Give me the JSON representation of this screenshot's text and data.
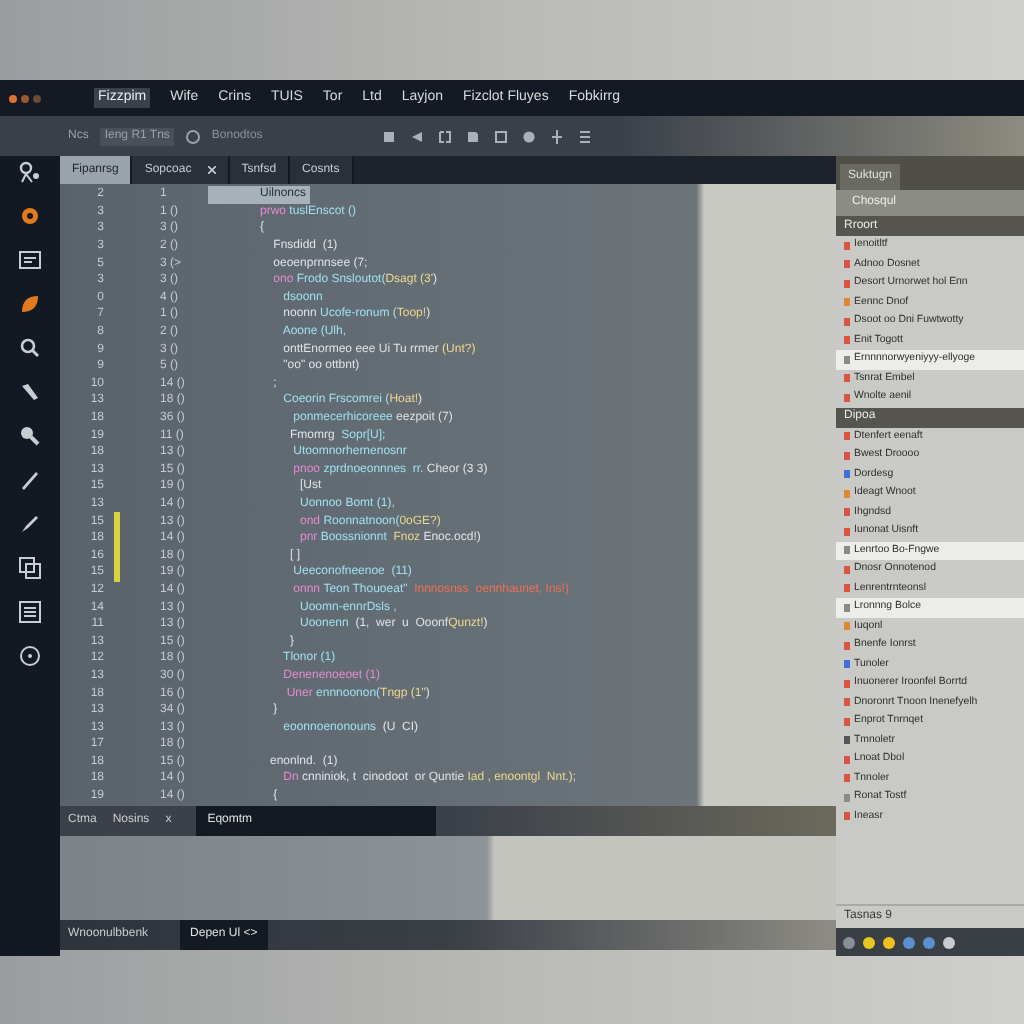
{
  "menu": [
    {
      "label": "Fizzpim",
      "selected": true
    },
    {
      "label": "Wife",
      "selected": false
    },
    {
      "label": "Crins",
      "selected": false
    },
    {
      "label": "TUIS",
      "selected": false
    },
    {
      "label": "Tor",
      "selected": false
    },
    {
      "label": "Ltd",
      "selected": false
    },
    {
      "label": "Layjon",
      "selected": false
    },
    {
      "label": "Fizclot Fluyes",
      "selected": false
    },
    {
      "label": "Fobkirrg",
      "selected": false
    }
  ],
  "toolbar": {
    "label": "Ncs",
    "field": "Ieng R1 Tns",
    "breadcrumb": "Bonodtos"
  },
  "tabs": [
    {
      "label": "Fipanrsg",
      "selected": true,
      "closable": false
    },
    {
      "label": "Sopcoac",
      "selected": false,
      "closable": true
    },
    {
      "label": "Tsnfsd",
      "selected": false,
      "closable": false
    },
    {
      "label": "Cosnts",
      "selected": false,
      "closable": false
    }
  ],
  "code": [
    {
      "n": "2",
      "m": "1",
      "current": true,
      "marked": false,
      "segs": [
        {
          "kind": "plain",
          "text": "Uilnoncs"
        }
      ]
    },
    {
      "n": "3",
      "m": "1 ()",
      "current": false,
      "marked": false,
      "segs": [
        {
          "kind": "kw",
          "text": "prwo "
        },
        {
          "kind": "fn",
          "text": "tuslEnscot ()"
        }
      ]
    },
    {
      "n": "3",
      "m": "3 ()",
      "current": false,
      "marked": false,
      "segs": [
        {
          "kind": "plain",
          "text": "{"
        }
      ]
    },
    {
      "n": "3",
      "m": "2 ()",
      "current": false,
      "marked": false,
      "segs": [
        {
          "kind": "plain",
          "text": "    Fnsdidd  (1)"
        }
      ]
    },
    {
      "n": "5",
      "m": "3 (>",
      "current": false,
      "marked": false,
      "segs": [
        {
          "kind": "plain",
          "text": "    oeoenprnnsee (7;"
        }
      ]
    },
    {
      "n": "3",
      "m": "3 ()",
      "current": false,
      "marked": false,
      "segs": [
        {
          "kind": "kw",
          "text": "    ono "
        },
        {
          "kind": "fn",
          "text": "Frodo Snsloutot("
        },
        {
          "kind": "str",
          "text": "Dsagt (3'"
        },
        {
          "kind": "plain",
          "text": ")"
        }
      ]
    },
    {
      "n": "0",
      "m": "4 ()",
      "current": false,
      "marked": false,
      "segs": [
        {
          "kind": "fn",
          "text": "       dsoonn"
        }
      ]
    },
    {
      "n": "7",
      "m": "1 ()",
      "current": false,
      "marked": false,
      "segs": [
        {
          "kind": "plain",
          "text": "       noonn "
        },
        {
          "kind": "fn",
          "text": "Ucofe-ronum ("
        },
        {
          "kind": "str",
          "text": "Toop!"
        },
        {
          "kind": "plain",
          "text": ")"
        }
      ]
    },
    {
      "n": "8",
      "m": "2 ()",
      "current": false,
      "marked": false,
      "segs": [
        {
          "kind": "fn",
          "text": "       Aoone (Ulh,"
        }
      ]
    },
    {
      "n": "9",
      "m": "3 ()",
      "current": false,
      "marked": false,
      "segs": [
        {
          "kind": "plain",
          "text": "       onttEnormeo eee Ui Tu rrmer "
        },
        {
          "kind": "str",
          "text": "(Unt?)"
        }
      ]
    },
    {
      "n": "9",
      "m": "5 ()",
      "current": false,
      "marked": false,
      "segs": [
        {
          "kind": "plain",
          "text": "       \"oo\" oo ottbnt)"
        }
      ]
    },
    {
      "n": "10",
      "m": "14 ()",
      "current": false,
      "marked": false,
      "segs": [
        {
          "kind": "plain",
          "text": "    ;"
        }
      ]
    },
    {
      "n": "13",
      "m": "18 ()",
      "current": false,
      "marked": false,
      "segs": [
        {
          "kind": "fn",
          "text": "       Coeorin Frscomrei ("
        },
        {
          "kind": "str",
          "text": "Hoat!"
        },
        {
          "kind": "plain",
          "text": ")"
        }
      ]
    },
    {
      "n": "18",
      "m": "36 ()",
      "current": false,
      "marked": false,
      "segs": [
        {
          "kind": "fn",
          "text": "          ponmecerhicoreee "
        },
        {
          "kind": "plain",
          "text": "eezpoit (7)"
        }
      ]
    },
    {
      "n": "19",
      "m": "11 ()",
      "current": false,
      "marked": false,
      "segs": [
        {
          "kind": "plain",
          "text": "         Fmomrg  "
        },
        {
          "kind": "fn",
          "text": "Sopr[U];"
        }
      ]
    },
    {
      "n": "18",
      "m": "13 ()",
      "current": false,
      "marked": false,
      "segs": [
        {
          "kind": "fn",
          "text": "          Utoomnorhernenosnr"
        }
      ]
    },
    {
      "n": "13",
      "m": "15 ()",
      "current": false,
      "marked": false,
      "segs": [
        {
          "kind": "kw",
          "text": "          pnoo "
        },
        {
          "kind": "fn",
          "text": "zprdnoeonnnes  rr. "
        },
        {
          "kind": "plain",
          "text": "Cheor (3 3)"
        }
      ]
    },
    {
      "n": "15",
      "m": "19 ()",
      "current": false,
      "marked": false,
      "segs": [
        {
          "kind": "plain",
          "text": "            [Ust"
        }
      ]
    },
    {
      "n": "13",
      "m": "14 ()",
      "current": false,
      "marked": false,
      "segs": [
        {
          "kind": "fn",
          "text": "            Uonnoo Bomt (1),"
        }
      ]
    },
    {
      "n": "15",
      "m": "13 ()",
      "current": false,
      "marked": true,
      "segs": [
        {
          "kind": "kw",
          "text": "            ond "
        },
        {
          "kind": "fn",
          "text": "Roonnatnoon("
        },
        {
          "kind": "str",
          "text": "0oGE?)"
        }
      ]
    },
    {
      "n": "18",
      "m": "14 ()",
      "current": false,
      "marked": true,
      "segs": [
        {
          "kind": "kw",
          "text": "            pnr "
        },
        {
          "kind": "fn",
          "text": "Boossnionnt  "
        },
        {
          "kind": "str",
          "text": "Fnoz "
        },
        {
          "kind": "plain",
          "text": "Enoc.ocd!)"
        }
      ]
    },
    {
      "n": "16",
      "m": "18 ()",
      "current": false,
      "marked": true,
      "segs": [
        {
          "kind": "plain",
          "text": "         [ ]"
        }
      ]
    },
    {
      "n": "15",
      "m": "19 ()",
      "current": false,
      "marked": true,
      "segs": [
        {
          "kind": "fn",
          "text": "          Ueeconofneenoe  (11)"
        }
      ]
    },
    {
      "n": "12",
      "m": "14 ()",
      "current": false,
      "marked": false,
      "segs": [
        {
          "kind": "kw",
          "text": "          onnn "
        },
        {
          "kind": "fn",
          "text": "Teon Thouoeat\"  "
        },
        {
          "kind": "err",
          "text": "Innnosnss  oennhaunet, Ins!)"
        }
      ]
    },
    {
      "n": "14",
      "m": "13 ()",
      "current": false,
      "marked": false,
      "segs": [
        {
          "kind": "fn",
          "text": "            Uoomn-ennrDsls ,"
        }
      ]
    },
    {
      "n": "11",
      "m": "13 ()",
      "current": false,
      "marked": false,
      "segs": [
        {
          "kind": "fn",
          "text": "            Uoonenn  "
        },
        {
          "kind": "plain",
          "text": "(1,  wer  u  Ooonf"
        },
        {
          "kind": "str",
          "text": "Qunzt!"
        },
        {
          "kind": "plain",
          "text": ")"
        }
      ]
    },
    {
      "n": "13",
      "m": "15 ()",
      "current": false,
      "marked": false,
      "segs": [
        {
          "kind": "plain",
          "text": "         }"
        }
      ]
    },
    {
      "n": "12",
      "m": "18 ()",
      "current": false,
      "marked": false,
      "segs": [
        {
          "kind": "fn",
          "text": "       Tlonor (1)"
        }
      ]
    },
    {
      "n": "13",
      "m": "30 ()",
      "current": false,
      "marked": false,
      "segs": [
        {
          "kind": "kw",
          "text": "       Denenenoeoet (1)"
        }
      ]
    },
    {
      "n": "18",
      "m": "16 ()",
      "current": false,
      "marked": false,
      "segs": [
        {
          "kind": "kw",
          "text": "        Uner "
        },
        {
          "kind": "fn",
          "text": "ennnoonon("
        },
        {
          "kind": "str",
          "text": "Tngp (1\""
        },
        {
          "kind": "plain",
          "text": ")"
        }
      ]
    },
    {
      "n": "13",
      "m": "34 ()",
      "current": false,
      "marked": false,
      "segs": [
        {
          "kind": "plain",
          "text": "    }"
        }
      ]
    },
    {
      "n": "13",
      "m": "13 ()",
      "current": false,
      "marked": false,
      "segs": [
        {
          "kind": "fn",
          "text": "       eoonnoenonouns  "
        },
        {
          "kind": "plain",
          "text": "(U  CI)"
        }
      ]
    },
    {
      "n": "17",
      "m": "18 ()",
      "current": false,
      "marked": false
    },
    {
      "n": "18",
      "m": "15 ()",
      "current": false,
      "marked": false,
      "segs": [
        {
          "kind": "plain",
          "text": "   enonlnd.  (1)"
        }
      ]
    },
    {
      "n": "18",
      "m": "14 ()",
      "current": false,
      "marked": false,
      "segs": [
        {
          "kind": "kw",
          "text": "       Dn "
        },
        {
          "kind": "plain",
          "text": "cnniniok, t  cinodoot  or Quntie "
        },
        {
          "kind": "str",
          "text": "Iad , enoontgl  Nnt.);"
        }
      ]
    },
    {
      "n": "19",
      "m": "14 ()",
      "current": false,
      "marked": false,
      "segs": [
        {
          "kind": "plain",
          "text": "    {"
        }
      ]
    }
  ],
  "panel_tabs": [
    {
      "label": "Ctma",
      "selected": false
    },
    {
      "label": "Nosins",
      "selected": false
    },
    {
      "label": "x",
      "selected": false
    },
    {
      "label": "Eqomtm",
      "selected": true
    }
  ],
  "status": [
    "Wnoonulbbenk",
    "Depen Ul <>"
  ],
  "sidebar": {
    "tab": "Suktugn",
    "button": "Chosqul",
    "footer": "Tasnas 9",
    "items": [
      {
        "kind": "section",
        "text": "Rroort"
      },
      {
        "kind": "item",
        "text": "Ienoitltf",
        "color": "#d9553f",
        "selected": false
      },
      {
        "kind": "item",
        "text": "Adnoo Dosnet",
        "color": "#d9553f",
        "selected": false
      },
      {
        "kind": "item",
        "text": "Desort Urnorwet hol Enn",
        "color": "#d9553f",
        "selected": false
      },
      {
        "kind": "item",
        "text": "Eennc Dnof",
        "color": "#e0892f",
        "selected": false
      },
      {
        "kind": "item",
        "text": "Dsoot oo Dni Fuwtwotty",
        "color": "#d9553f",
        "selected": false
      },
      {
        "kind": "item",
        "text": "Enit Togott",
        "color": "#d9553f",
        "selected": false
      },
      {
        "kind": "item",
        "text": "Ernnnnorwyeniyyy-ellyoge",
        "color": "#8a8a8a",
        "selected": true
      },
      {
        "kind": "item",
        "text": "Tsnrat Embel",
        "color": "#d9553f",
        "selected": false
      },
      {
        "kind": "item",
        "text": "Wnolte aenil",
        "color": "#d9553f",
        "selected": false
      },
      {
        "kind": "section",
        "text": "Dipoa"
      },
      {
        "kind": "item",
        "text": "Dtenfert eenaft",
        "color": "#d9553f",
        "selected": false
      },
      {
        "kind": "item",
        "text": "Bwest Droooo",
        "color": "#d9553f",
        "selected": false
      },
      {
        "kind": "item",
        "text": "Dordesg",
        "color": "#3f6fd9",
        "selected": false
      },
      {
        "kind": "item",
        "text": "Ideagt Wnoot",
        "color": "#e0892f",
        "selected": false
      },
      {
        "kind": "item",
        "text": "Ihgndsd",
        "color": "#d9553f",
        "selected": false
      },
      {
        "kind": "item",
        "text": "Iunonat Uisnft",
        "color": "#d9553f",
        "selected": false
      },
      {
        "kind": "item",
        "text": "Lenrtoo Bo-Fngwe",
        "color": "#8a8a8a",
        "selected": true
      },
      {
        "kind": "item",
        "text": "Dnosr Onnotenod",
        "color": "#d9553f",
        "selected": false
      },
      {
        "kind": "item",
        "text": "Lenrentrnteonsl",
        "color": "#d9553f",
        "selected": false
      },
      {
        "kind": "item",
        "text": "Lronnng Bolce",
        "color": "#8a8a8a",
        "selected": true
      },
      {
        "kind": "item",
        "text": "Iuqonl",
        "color": "#e0892f",
        "selected": false
      },
      {
        "kind": "item",
        "text": "Bnenfe Ionrst",
        "color": "#d9553f",
        "selected": false
      },
      {
        "kind": "item",
        "text": "Tunoler",
        "color": "#3f6fd9",
        "selected": false
      },
      {
        "kind": "item",
        "text": "Inuonerer Iroonfel Borrtd",
        "color": "#d9553f",
        "selected": false
      },
      {
        "kind": "item",
        "text": "Dnoronrt Tnoon Inenefyelh",
        "color": "#d9553f",
        "selected": false
      },
      {
        "kind": "item",
        "text": "Enprot Tnrnqet",
        "color": "#d9553f",
        "selected": false
      },
      {
        "kind": "item",
        "text": "Tmnoletr",
        "color": "#555555",
        "selected": false
      },
      {
        "kind": "item",
        "text": "Lnoat Dbol",
        "color": "#d9553f",
        "selected": false
      },
      {
        "kind": "item",
        "text": "Tnnoler",
        "color": "#d9553f",
        "selected": false
      },
      {
        "kind": "item",
        "text": "Ronat Tostf",
        "color": "#8a8a8a",
        "selected": false
      },
      {
        "kind": "item",
        "text": "Ineasr",
        "color": "#d9553f",
        "selected": false
      }
    ]
  }
}
